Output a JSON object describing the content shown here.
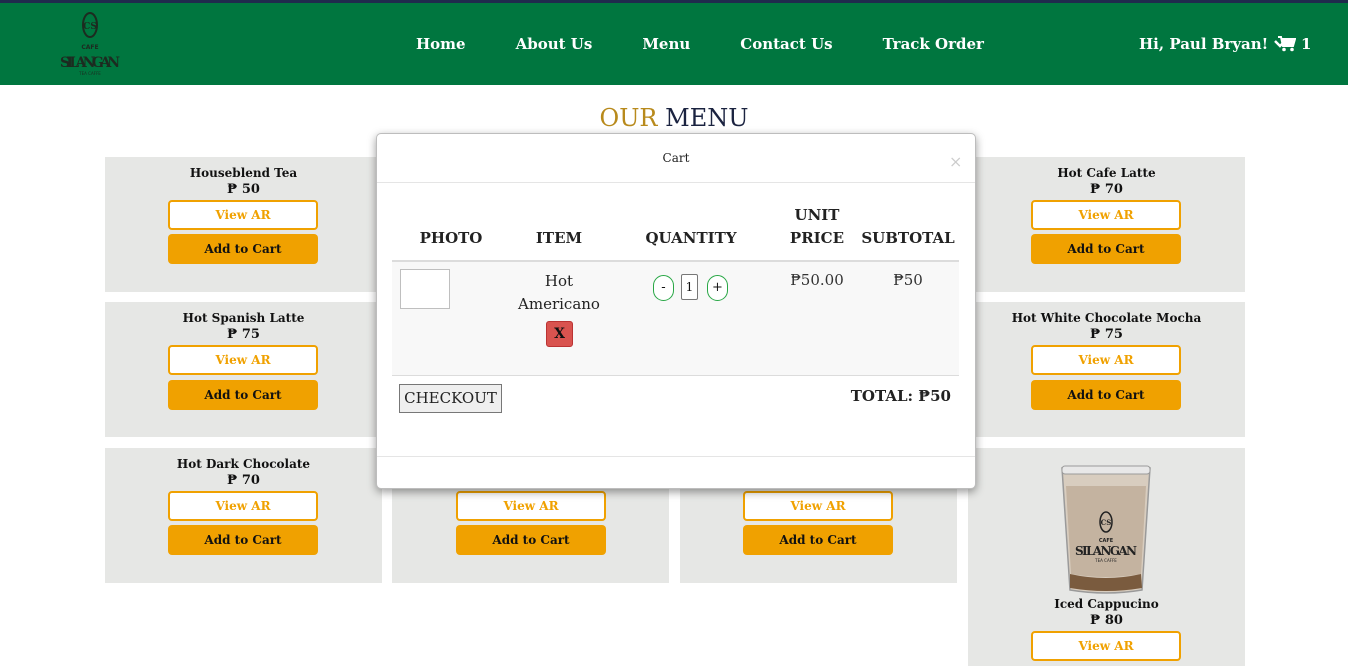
{
  "brand": {
    "logo_name": "CAFE SILANGAN",
    "logo_sub": "TEA CAFFE",
    "logo_initials": "CS"
  },
  "nav": {
    "links": [
      "Home",
      "About Us",
      "Menu",
      "Contact Us",
      "Track Order"
    ],
    "user_greeting": "Hi, Paul Bryan!",
    "cart_count": "1"
  },
  "menu": {
    "title_accent": "OUR",
    "title_rest": "MENU",
    "view_ar_label": "View AR",
    "add_to_cart_label": "Add to Cart",
    "items": [
      {
        "name": "Houseblend Tea",
        "price": "₱ 50"
      },
      {
        "name": "Hot Cafe Latte",
        "price": "₱ 70"
      },
      {
        "name": "Hot Spanish Latte",
        "price": "₱ 75"
      },
      {
        "name": "Hot White Chocolate Mocha",
        "price": "₱ 75"
      },
      {
        "name": "Hot Dark Chocolate",
        "price": "₱ 70"
      },
      {
        "name": "Iced Cappucino",
        "price": "₱ 80"
      }
    ]
  },
  "cart_modal": {
    "title": "Cart",
    "close": "×",
    "headers": {
      "photo": "PHOTO",
      "item": "ITEM",
      "quantity": "QUANTITY",
      "unit_price_line1": "UNIT",
      "unit_price_line2": "PRICE",
      "subtotal": "SUBTOTAL"
    },
    "row": {
      "item_line1": "Hot",
      "item_line2": "Americano",
      "remove": "X",
      "minus": "-",
      "qty": "1",
      "plus": "+",
      "unit_price": "₱50.00",
      "subtotal": "₱50"
    },
    "checkout_label": "CHECKOUT",
    "total_label": "TOTAL: ₱50"
  },
  "colors": {
    "nav_bg": "#00763f",
    "accent": "#f0a100",
    "title_gold": "#b88a1c",
    "remove_red": "#d9534f"
  }
}
